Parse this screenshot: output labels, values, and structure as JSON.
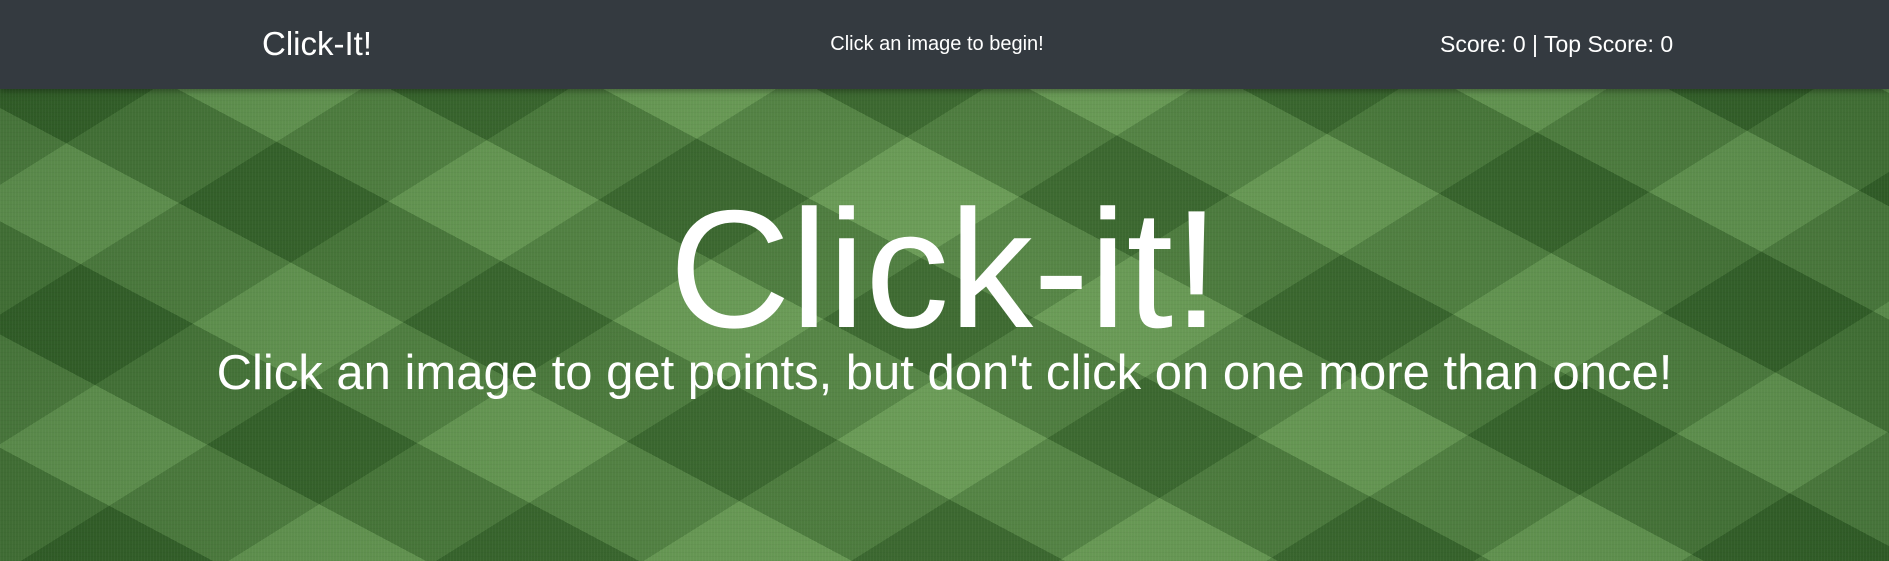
{
  "navbar": {
    "brand": "Click-It!",
    "message": "Click an image to begin!",
    "score_text": "Score: 0 | Top Score: 0"
  },
  "hero": {
    "title": "Click-it!",
    "subtitle": "Click an image to get points, but don't click on one more than once!"
  },
  "colors": {
    "navbar_bg": "#343a40",
    "text": "#ffffff",
    "grass": "#4a7e3e"
  }
}
